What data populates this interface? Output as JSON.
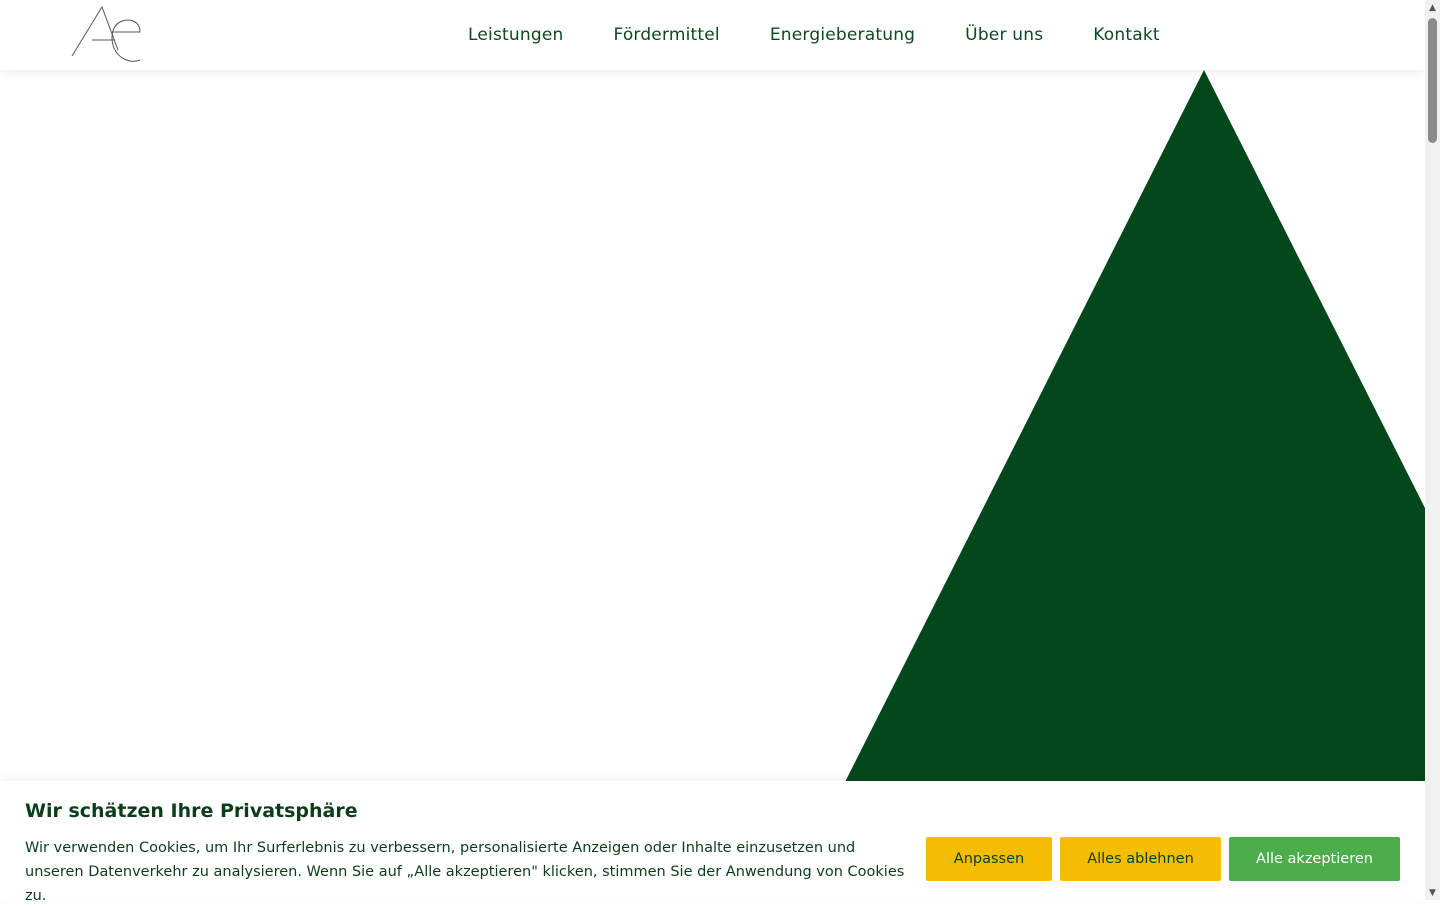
{
  "header": {
    "logo_text": "Ae",
    "nav": [
      "Leistungen",
      "Fördermittel",
      "Energieberatung",
      "Über uns",
      "Kontakt"
    ]
  },
  "colors": {
    "brand_green": "#04471b",
    "nav_text": "#0c4a1e",
    "button_yellow": "#f5bd02",
    "button_green": "#4cad4b"
  },
  "cookie": {
    "title": "Wir schätzen Ihre Privatsphäre",
    "text": "Wir verwenden Cookies, um Ihr Surferlebnis zu verbessern, personalisierte Anzeigen oder Inhalte einzusetzen und unseren Datenverkehr zu analysieren. Wenn Sie auf „Alle akzeptieren\" klicken, stimmen Sie der Anwendung von Cookies zu.",
    "customize_label": "Anpassen",
    "reject_label": "Alles ablehnen",
    "accept_label": "Alle akzeptieren"
  },
  "icons": {
    "scroll_up": "arrow-up-icon",
    "scroll_down": "arrow-down-icon"
  }
}
